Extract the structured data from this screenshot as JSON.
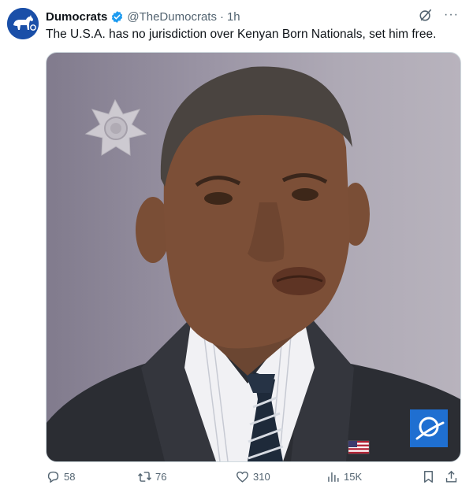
{
  "tweet": {
    "author_name": "Dumocrats",
    "handle": "@TheDumocrats",
    "separator": "·",
    "time": "1h",
    "text": "The U.S.A. has no jurisdiction over Kenyan Born Nationals, set him free.",
    "verified_color": "#1d9bf0",
    "avatar_color": "#1a4fa8"
  },
  "media": {
    "description_icons": [
      "sheriff-badge",
      "american-flag-pin",
      "news-logo"
    ]
  },
  "actions": {
    "replies": "58",
    "retweets": "76",
    "likes": "310",
    "views": "15K"
  },
  "icons": {
    "more": "···",
    "grok": "grok-icon"
  }
}
